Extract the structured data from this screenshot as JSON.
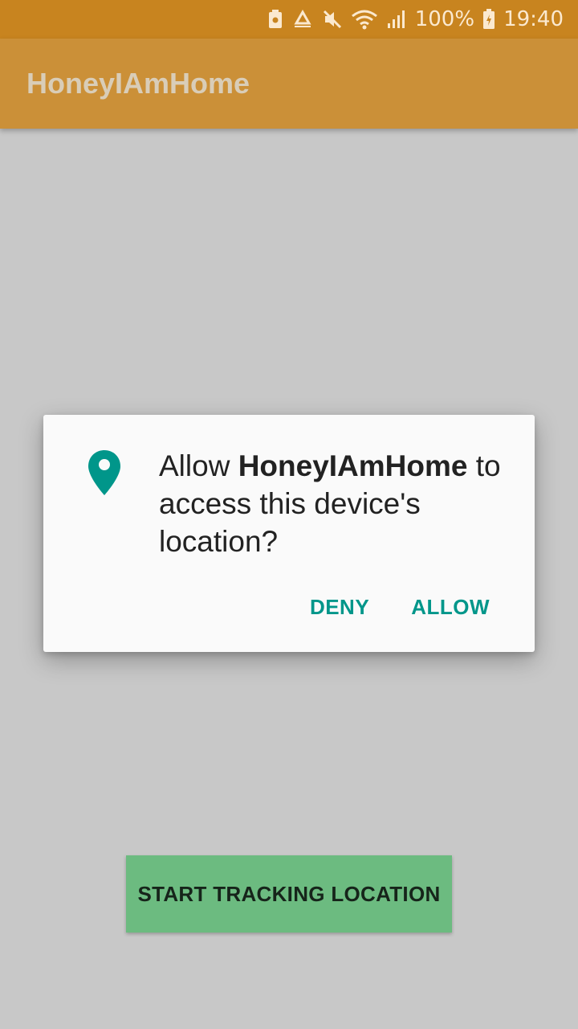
{
  "status_bar": {
    "battery_percent": "100%",
    "time": "19:40",
    "icons": [
      "notification-icon",
      "recycle-icon",
      "mute-icon",
      "wifi-icon",
      "signal-icon",
      "battery-charging-icon"
    ]
  },
  "app_bar": {
    "title": "HoneyIAmHome"
  },
  "dialog": {
    "icon": "location-pin-icon",
    "message_prefix": "Allow ",
    "app_name": "HoneyIAmHome",
    "message_suffix": " to access this device's location?",
    "deny_label": "DENY",
    "allow_label": "ALLOW"
  },
  "main": {
    "start_button_label": "START TRACKING LOCATION"
  },
  "colors": {
    "status_bar": "#c8841f",
    "app_bar": "#cb9038",
    "background": "#c8c8c8",
    "dialog_accent": "#00968a",
    "button": "#6cbb80"
  }
}
